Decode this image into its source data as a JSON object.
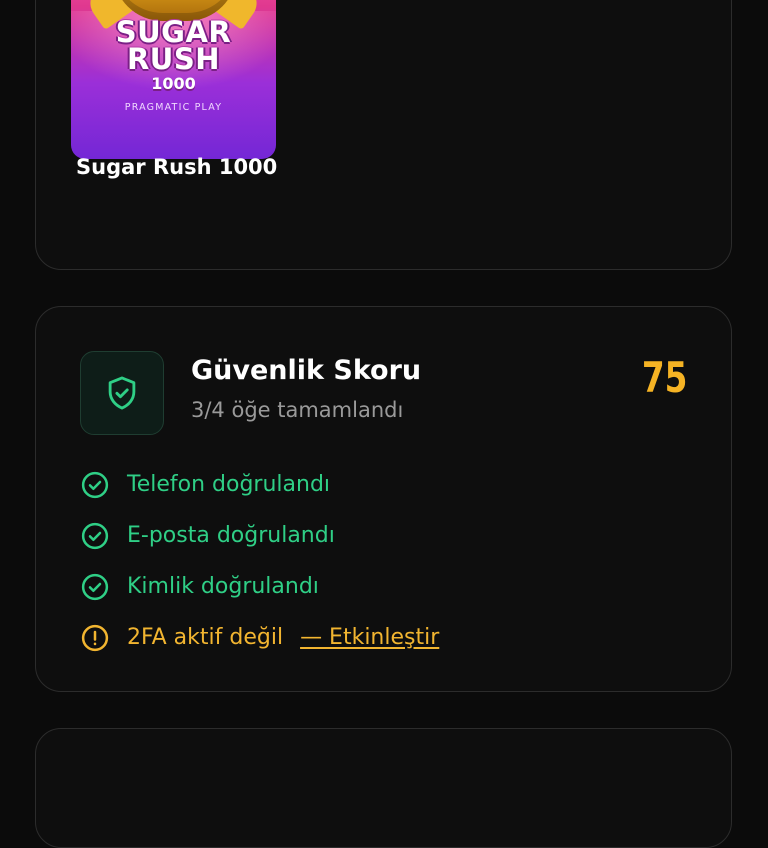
{
  "game_card": {
    "thumbnail": {
      "title_line1": "SUGAR",
      "title_line2": "RUSH",
      "title_number": "1000",
      "provider": "PRAGMATIC PLAY"
    },
    "name": "Sugar Rush 1000"
  },
  "security": {
    "icon": "shield-check-icon",
    "title": "Güvenlik Skoru",
    "subtitle": "3/4 öğe tamamlandı",
    "score": "75",
    "items": [
      {
        "label": "Telefon doğrulandı",
        "status": "done",
        "icon": "check-circle-icon"
      },
      {
        "label": "E-posta doğrulandı",
        "status": "done",
        "icon": "check-circle-icon"
      },
      {
        "label": "Kimlik doğrulandı",
        "status": "done",
        "icon": "check-circle-icon"
      },
      {
        "label": "2FA aktif değil",
        "status": "warning",
        "icon": "alert-circle-icon",
        "action_label": "— Etkinleştir"
      }
    ]
  },
  "colors": {
    "success": "#2fcf86",
    "warning": "#f2b530",
    "score": "#f5b324",
    "background": "#0b0b0b",
    "card_border": "#2c2c2c"
  }
}
